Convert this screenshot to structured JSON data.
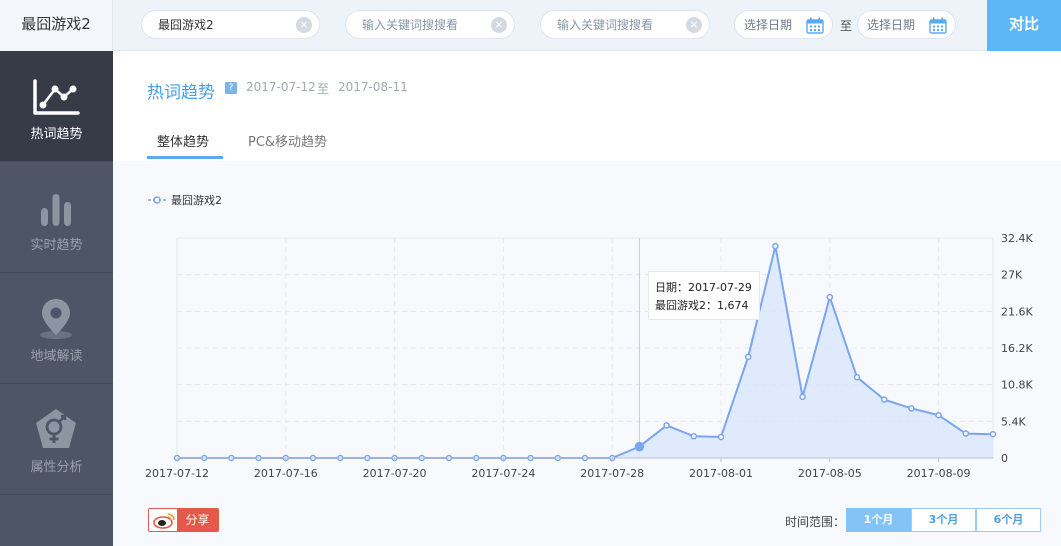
{
  "app_title": "最囧游戏2",
  "search": {
    "keyword1_value": "最囧游戏2",
    "keyword2_placeholder": "输入关键词搜搜看",
    "keyword3_placeholder": "输入关键词搜搜看",
    "start_date_placeholder": "选择日期",
    "end_date_placeholder": "选择日期",
    "date_separator": "至",
    "compare_label": "对比",
    "clear_icon": "×"
  },
  "sidebar": {
    "items": [
      {
        "label": "热词趋势",
        "icon": "line-chart-icon",
        "active": true
      },
      {
        "label": "实时趋势",
        "icon": "bar-chart-icon",
        "active": false
      },
      {
        "label": "地域解读",
        "icon": "map-pin-icon",
        "active": false
      },
      {
        "label": "属性分析",
        "icon": "gender-icon",
        "active": false
      }
    ]
  },
  "header": {
    "title": "热词趋势",
    "help_icon": "?",
    "start_date": "2017-07-12",
    "date_to": "至",
    "end_date": "2017-08-11"
  },
  "tabs": [
    {
      "label": "整体趋势",
      "active": true
    },
    {
      "label": "PC&移动趋势",
      "active": false
    }
  ],
  "colors": {
    "accent": "#4a9ee6",
    "series": "#7aa6ef",
    "area": "#dbe8fb",
    "sidebar_bg": "#4e5566",
    "sidebar_active": "#363b47",
    "share": "#e5584a"
  },
  "chart_data": {
    "type": "area",
    "series": [
      {
        "name": "最囧游戏2",
        "values": [
          0,
          0,
          0,
          0,
          0,
          0,
          0,
          0,
          0,
          0,
          0,
          0,
          0,
          0,
          0,
          0,
          0,
          1674,
          4800,
          3200,
          3100,
          14900,
          31200,
          9000,
          23700,
          11900,
          8600,
          7300,
          6300,
          3600,
          3500
        ]
      }
    ],
    "x_start": "2017-07-12",
    "x_end": "2017-08-11",
    "x_tick_labels": [
      "2017-07-12",
      "2017-07-16",
      "2017-07-20",
      "2017-07-24",
      "2017-07-28",
      "2017-08-01",
      "2017-08-05",
      "2017-08-09"
    ],
    "y_tick_labels": [
      "0",
      "5.4K",
      "10.8K",
      "16.2K",
      "21.6K",
      "27K",
      "32.4K"
    ],
    "ylim": [
      0,
      32400
    ],
    "grid": true,
    "legend": "top-left",
    "tooltip": {
      "date_label": "日期：2017-07-29",
      "value_label": "最囧游戏2：1,674"
    }
  },
  "footer": {
    "share_label": "分享",
    "range_label": "时间范围：",
    "range_options": [
      "1个月",
      "3个月",
      "6个月"
    ],
    "range_active": 0
  }
}
